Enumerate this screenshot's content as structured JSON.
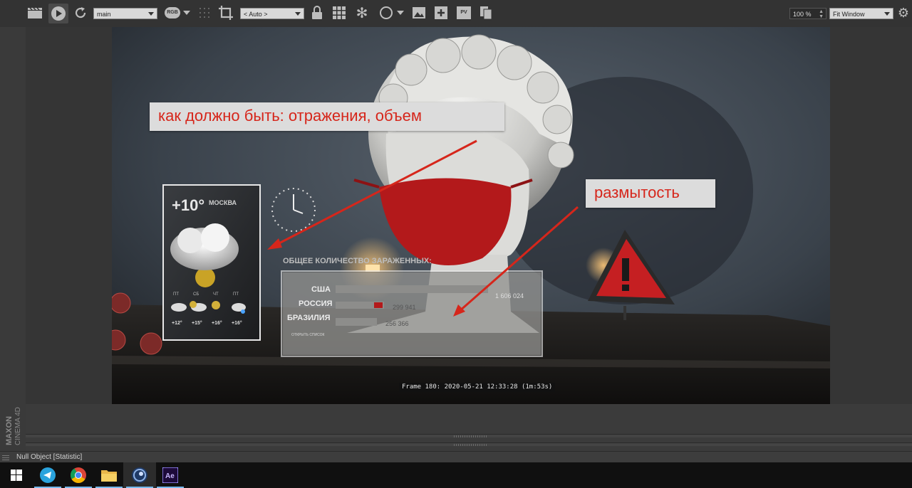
{
  "toolbar": {
    "camera_select": "main",
    "rgb_label": "RGB",
    "region_select": "< Auto >",
    "pv_label": "PV",
    "zoom_value": "100 %",
    "fit_select": "Fit Window"
  },
  "brand": {
    "maxon": "MAXON",
    "cinema": "CINEMA 4D"
  },
  "render": {
    "frame_info": "Frame 180: 2020-05-21 12:33:28 (1m:53s)"
  },
  "annotations": {
    "top": "как должно быть: отражения, объем",
    "right": "размытость"
  },
  "scene": {
    "weather": {
      "temp": "+10°",
      "city": "МОСКВА",
      "days": [
        "ПТ",
        "СБ",
        "ЧТ",
        "ПТ"
      ],
      "day_temps": [
        "+12°",
        "+15°",
        "+16°",
        "+16°"
      ]
    },
    "stats": {
      "title": "ОБЩЕЕ КОЛИЧЕСТВО ЗАРАЖЕННЫХ:",
      "rows": [
        {
          "country": "США",
          "value": "1 606 024"
        },
        {
          "country": "РОССИЯ",
          "value": "299 941"
        },
        {
          "country": "БРАЗИЛИЯ",
          "value": "256 366"
        }
      ],
      "footer": "ОТКРЫТЬ СПИСОК"
    }
  },
  "status": {
    "text": "Null Object [Statistic]"
  },
  "colors": {
    "annotation_text": "#d6261b",
    "mask": "#b3191b",
    "taskbar": "#101010"
  }
}
